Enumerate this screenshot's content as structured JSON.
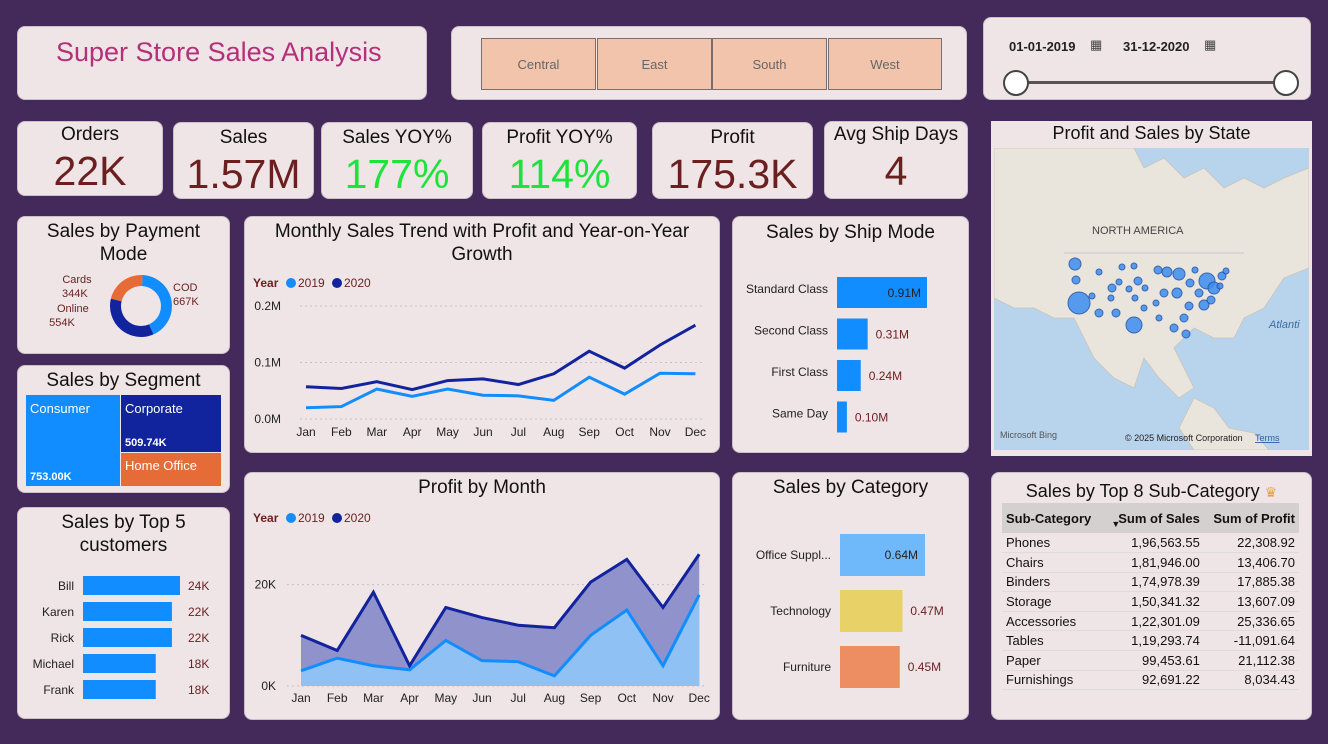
{
  "title": "Super Store Sales Analysis",
  "regions": [
    "Central",
    "East",
    "South",
    "West"
  ],
  "date_range": {
    "start": "01-01-2019",
    "end": "31-12-2020",
    "start_value": "2019-01-01",
    "end_value": "2020-12-31"
  },
  "kpis": [
    {
      "label": "Orders",
      "value": "22K",
      "color": "#6b1f1f"
    },
    {
      "label": "Sales",
      "value": "1.57M",
      "color": "#6b1f1f"
    },
    {
      "label": "Sales YOY%",
      "value": "177%",
      "color": "#1ee33a"
    },
    {
      "label": "Profit YOY%",
      "value": "114%",
      "color": "#1ee33a"
    },
    {
      "label": "Profit",
      "value": "175.3K",
      "color": "#6b1f1f"
    },
    {
      "label": "Avg Ship Days",
      "value": "4",
      "color": "#6b1f1f"
    }
  ],
  "colors": {
    "y2019": "#118dff",
    "y2020": "#12239e",
    "orange": "#e66c37",
    "bar": "#118dff",
    "background": "#442a5a",
    "card": "#efe4e6"
  },
  "payment": {
    "title": "Sales by Payment Mode",
    "items": [
      {
        "name": "COD",
        "value": 667,
        "label": "667K",
        "color": "#118dff"
      },
      {
        "name": "Online",
        "value": 554,
        "label": "554K",
        "color": "#12239e"
      },
      {
        "name": "Cards",
        "value": 344,
        "label": "344K",
        "color": "#e66c37"
      }
    ]
  },
  "segment": {
    "title": "Sales by Segment",
    "items": [
      {
        "name": "Consumer",
        "value": "753.00K"
      },
      {
        "name": "Corporate",
        "value": "509.74K"
      },
      {
        "name": "Home Office",
        "value": ""
      }
    ]
  },
  "customers": {
    "title": "Sales by Top 5 customers",
    "items": [
      {
        "name": "Bill",
        "value": 24,
        "label": "24K"
      },
      {
        "name": "Karen",
        "value": 22,
        "label": "22K"
      },
      {
        "name": "Rick",
        "value": 22,
        "label": "22K"
      },
      {
        "name": "Michael",
        "value": 18,
        "label": "18K"
      },
      {
        "name": "Frank",
        "value": 18,
        "label": "18K"
      }
    ]
  },
  "monthly": {
    "title": "Monthly Sales Trend with Profit and Year-on-Year Growth",
    "legend_title": "Year",
    "months": [
      "Jan",
      "Feb",
      "Mar",
      "Apr",
      "May",
      "Jun",
      "Jul",
      "Aug",
      "Sep",
      "Oct",
      "Nov",
      "Dec"
    ],
    "y_ticks": [
      "0.2M",
      "0.1M",
      "0.0M"
    ],
    "y_tick_values": [
      0.2,
      0.1,
      0.0
    ],
    "series": [
      {
        "name": "2019",
        "values": [
          0.02,
          0.022,
          0.053,
          0.04,
          0.053,
          0.042,
          0.041,
          0.033,
          0.074,
          0.044,
          0.081,
          0.08
        ]
      },
      {
        "name": "2020",
        "values": [
          0.057,
          0.054,
          0.066,
          0.052,
          0.068,
          0.071,
          0.061,
          0.08,
          0.12,
          0.09,
          0.131,
          0.166
        ]
      }
    ]
  },
  "profit": {
    "title": "Profit by Month",
    "legend_title": "Year",
    "months": [
      "Jan",
      "Feb",
      "Mar",
      "Apr",
      "May",
      "Jun",
      "Jul",
      "Aug",
      "Sep",
      "Oct",
      "Nov",
      "Dec"
    ],
    "y_ticks": [
      "20K",
      "0K"
    ],
    "y_tick_values": [
      20,
      0
    ],
    "series": [
      {
        "name": "2019",
        "values": [
          3,
          5.5,
          4,
          3.2,
          9,
          5,
          4.8,
          2,
          10,
          15,
          4,
          18
        ]
      },
      {
        "name": "2020",
        "values": [
          10,
          7,
          18.5,
          4,
          15.5,
          13.5,
          12,
          11.5,
          20.5,
          25,
          15.5,
          26
        ]
      }
    ]
  },
  "shipmode": {
    "title": "Sales by Ship Mode",
    "items": [
      {
        "name": "Standard Class",
        "value": 0.91,
        "label": "0.91M"
      },
      {
        "name": "Second Class",
        "value": 0.31,
        "label": "0.31M"
      },
      {
        "name": "First Class",
        "value": 0.24,
        "label": "0.24M"
      },
      {
        "name": "Same Day",
        "value": 0.1,
        "label": "0.10M"
      }
    ]
  },
  "category": {
    "title": "Sales by Category",
    "items": [
      {
        "name": "Office Suppl...",
        "value": 0.64,
        "label": "0.64M",
        "color": "#6fb8f9"
      },
      {
        "name": "Technology",
        "value": 0.47,
        "label": "0.47M",
        "color": "#e8d166"
      },
      {
        "name": "Furniture",
        "value": 0.45,
        "label": "0.45M",
        "color": "#ec8e62"
      }
    ]
  },
  "map": {
    "title": "Profit and Sales by State",
    "continent": "NORTH AMERICA",
    "ocean": "Atlanti",
    "bing": "Microsoft Bing",
    "copyright": "© 2025 Microsoft Corporation",
    "terms": "Terms"
  },
  "subcat": {
    "title": "Sales by Top 8 Sub-Category",
    "headers": [
      "Sub-Category",
      "Sum of Sales",
      "Sum of Profit"
    ],
    "rows": [
      [
        "Phones",
        "1,96,563.55",
        "22,308.92"
      ],
      [
        "Chairs",
        "1,81,946.00",
        "13,406.70"
      ],
      [
        "Binders",
        "1,74,978.39",
        "17,885.38"
      ],
      [
        "Storage",
        "1,50,341.32",
        "13,607.09"
      ],
      [
        "Accessories",
        "1,22,301.09",
        "25,336.65"
      ],
      [
        "Tables",
        "1,19,293.74",
        "-11,091.64"
      ],
      [
        "Paper",
        "99,453.61",
        "21,112.38"
      ],
      [
        "Furnishings",
        "92,691.22",
        "8,034.43"
      ]
    ]
  }
}
